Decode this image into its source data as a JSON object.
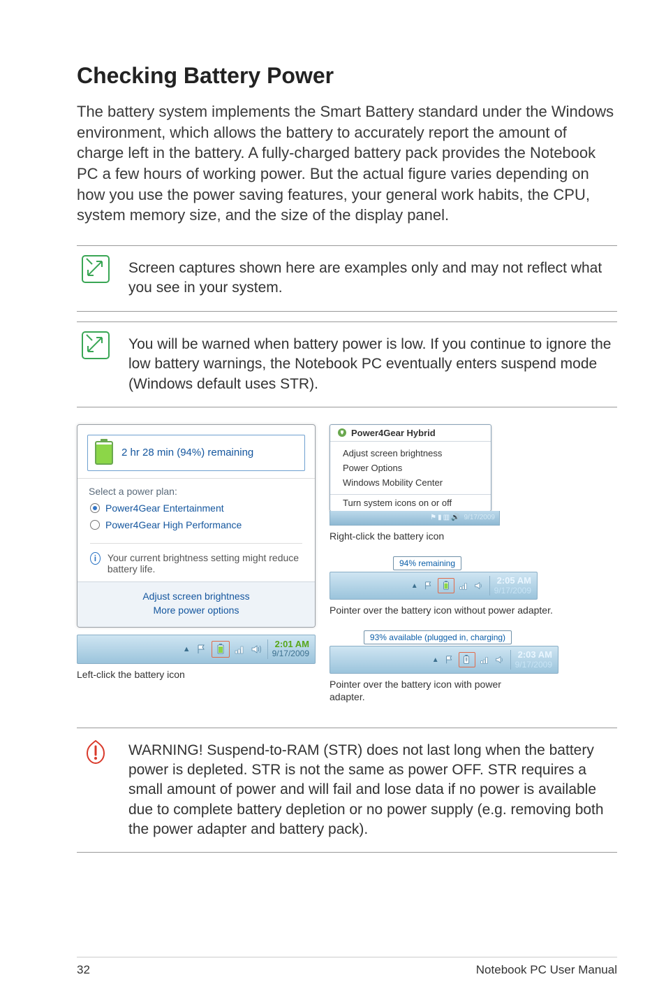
{
  "heading": "Checking Battery Power",
  "intro": "The battery system implements the Smart Battery standard under the Windows environment, which allows the battery to accurately report the amount of charge left in the battery. A fully-charged battery pack provides the Notebook PC a few hours of working power. But the actual figure varies depending on how you use the power saving features, your general work habits, the CPU, system memory size, and the size of the display panel.",
  "note1": "Screen captures shown here are examples only and may not reflect what you see in your system.",
  "note2": "You will be warned when battery power is low. If you continue to ignore the low battery warnings, the Notebook PC eventually enters suspend mode (Windows default uses STR).",
  "left_popup": {
    "remaining": "2 hr 28 min (94%) remaining",
    "select_label": "Select a power plan:",
    "plan1": "Power4Gear Entertainment",
    "plan2": "Power4Gear High Performance",
    "info": "Your current brightness setting might reduce battery life.",
    "action1": "Adjust screen brightness",
    "action2": "More power options",
    "time": "2:01 AM",
    "date": "9/17/2009"
  },
  "left_caption": "Left-click the battery icon",
  "ctx": {
    "title": "Power4Gear Hybrid",
    "adjust": "Adjust screen brightness",
    "power": "Power Options",
    "wmc": "Windows Mobility Center",
    "turn": "Turn system icons on or off",
    "date": "9/17/2009"
  },
  "right_caption1": "Right-click the battery icon",
  "tt1": {
    "text": "94% remaining",
    "time": "2:05 AM",
    "date": "9/17/2009"
  },
  "right_caption2": "Pointer over the battery icon without power adapter.",
  "tt2": {
    "text": "93% available (plugged in, charging)",
    "time": "2:03 AM",
    "date": "9/17/2009"
  },
  "right_caption3": "Pointer over the battery icon with power adapter.",
  "warning": "WARNING!  Suspend-to-RAM (STR) does not last long when the battery power is depleted. STR is not the same as power OFF. STR requires a small amount of power and will fail and lose data if no power is available due to complete battery depletion or no power supply (e.g. removing both the power adapter and battery pack).",
  "footer": {
    "page": "32",
    "label": "Notebook PC User Manual"
  }
}
